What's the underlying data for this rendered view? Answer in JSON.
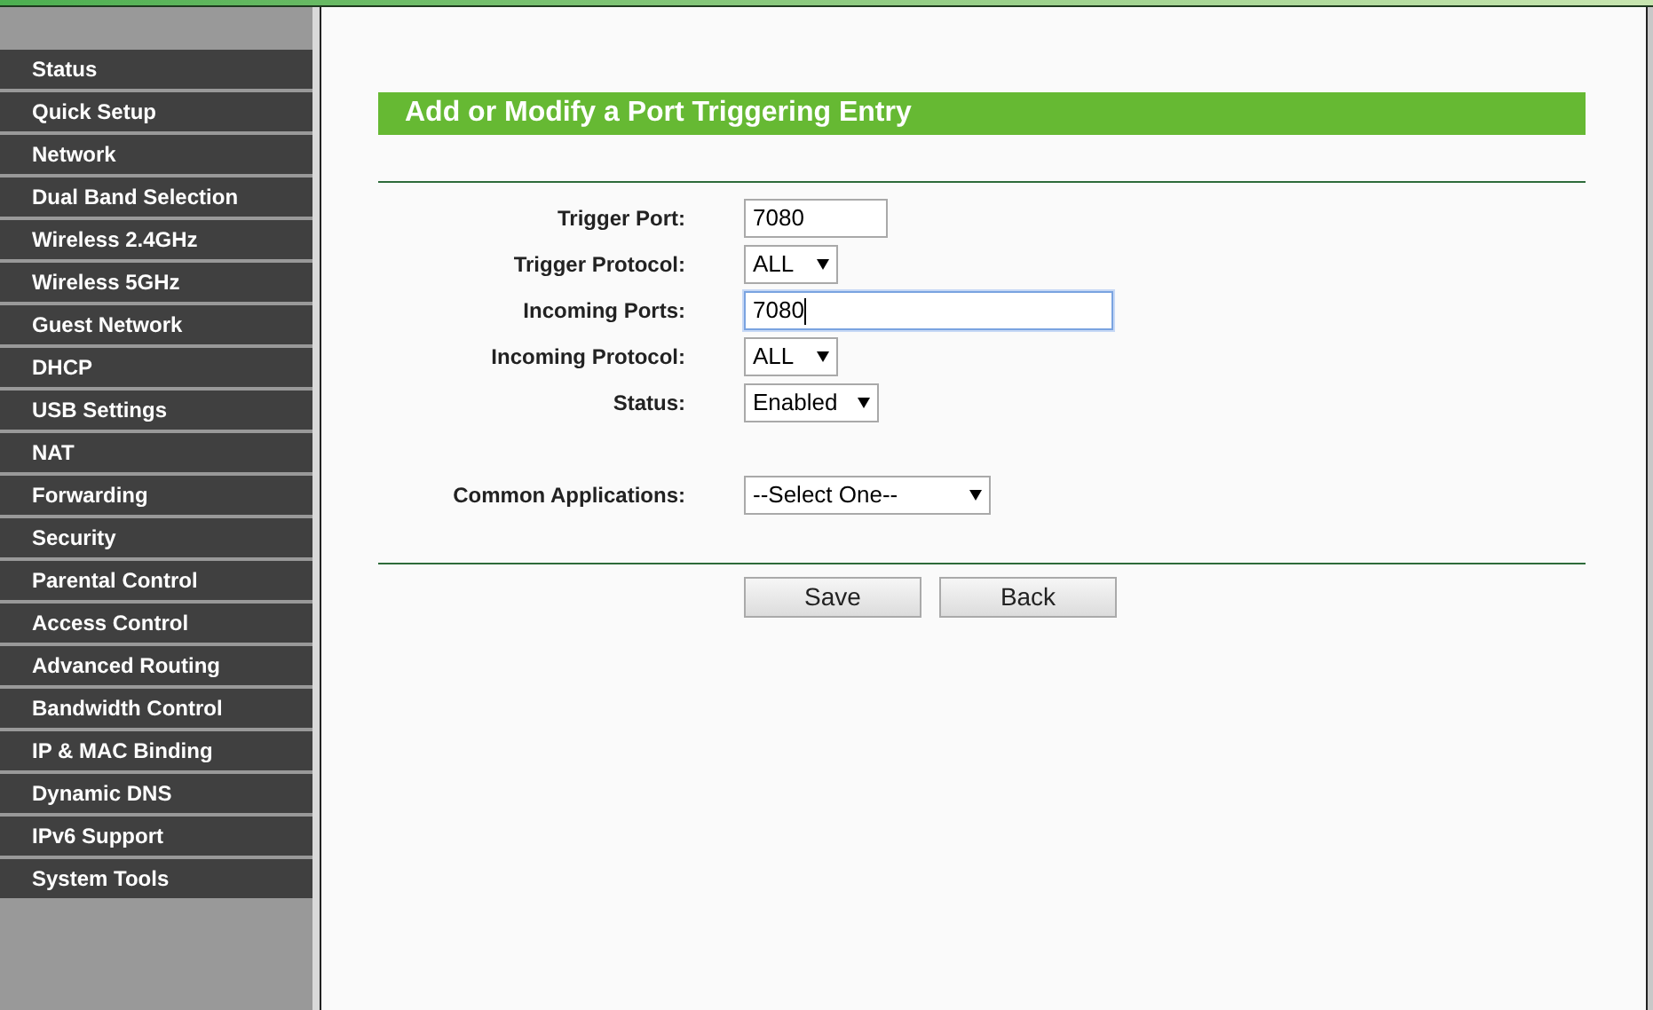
{
  "sidebar": {
    "items": [
      {
        "label": "Status",
        "selected": false
      },
      {
        "label": "Quick Setup",
        "selected": false
      },
      {
        "label": "Network",
        "selected": false
      },
      {
        "label": "Dual Band Selection",
        "selected": false
      },
      {
        "label": "Wireless 2.4GHz",
        "selected": false
      },
      {
        "label": "Wireless 5GHz",
        "selected": false
      },
      {
        "label": "Guest Network",
        "selected": false
      },
      {
        "label": "DHCP",
        "selected": false
      },
      {
        "label": "USB Settings",
        "selected": false
      },
      {
        "label": "NAT",
        "selected": false
      },
      {
        "label": "Forwarding",
        "selected": false
      },
      {
        "label": "Security",
        "selected": false
      },
      {
        "label": "Parental Control",
        "selected": false
      },
      {
        "label": "Access Control",
        "selected": false
      },
      {
        "label": "Advanced Routing",
        "selected": false
      },
      {
        "label": "Bandwidth Control",
        "selected": false
      },
      {
        "label": "IP & MAC Binding",
        "selected": false
      },
      {
        "label": "Dynamic DNS",
        "selected": false
      },
      {
        "label": "IPv6 Support",
        "selected": false
      },
      {
        "label": "System Tools",
        "selected": false
      }
    ]
  },
  "form": {
    "title": "Add or Modify a Port Triggering Entry",
    "fields": [
      {
        "kind": "text",
        "label": "Trigger Port:",
        "value": "7080",
        "focused": false
      },
      {
        "kind": "select",
        "label": "Trigger Protocol:",
        "value": "ALL"
      },
      {
        "kind": "text",
        "label": "Incoming Ports:",
        "value": "7080",
        "focused": true
      },
      {
        "kind": "select",
        "label": "Incoming Protocol:",
        "value": "ALL"
      },
      {
        "kind": "select",
        "label": "Status:",
        "value": "Enabled"
      },
      {
        "kind": "gap"
      },
      {
        "kind": "select",
        "label": "Common Applications:",
        "value": "--Select One--"
      }
    ],
    "buttons": [
      "Save",
      "Back"
    ]
  }
}
